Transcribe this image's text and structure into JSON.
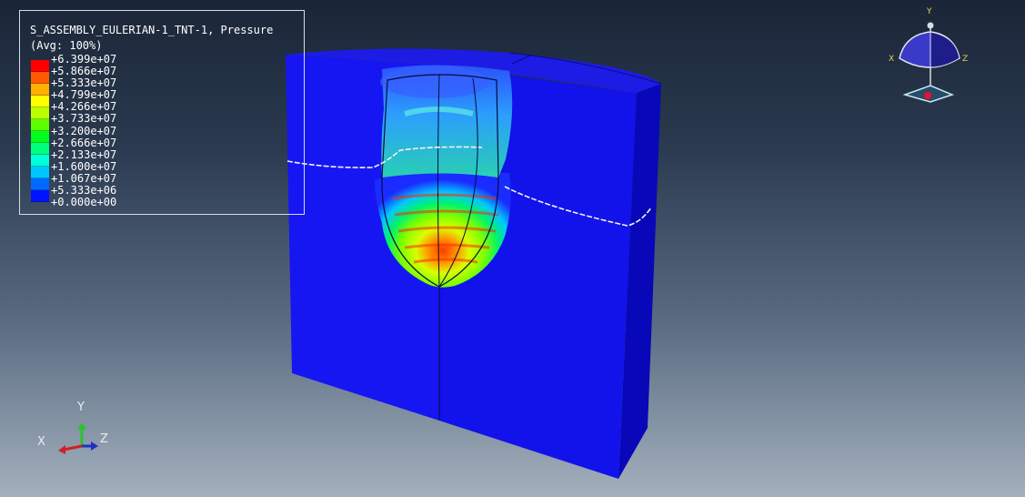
{
  "legend": {
    "title": "S_ASSEMBLY_EULERIAN-1_TNT-1, Pressure",
    "subtitle": "(Avg: 100%)",
    "values": [
      "+6.399e+07",
      "+5.866e+07",
      "+5.333e+07",
      "+4.799e+07",
      "+4.266e+07",
      "+3.733e+07",
      "+3.200e+07",
      "+2.666e+07",
      "+2.133e+07",
      "+1.600e+07",
      "+1.067e+07",
      "+5.333e+06",
      "+0.000e+00"
    ],
    "colors": [
      "#ff0000",
      "#ff5a00",
      "#ffb000",
      "#ffff00",
      "#b9ff00",
      "#5cff00",
      "#00ff21",
      "#00ff7e",
      "#00ffdc",
      "#00c6ff",
      "#006aff",
      "#0014ff"
    ]
  },
  "view_cube": {
    "axis_y": "Y",
    "axis_x": "X",
    "axis_z": "Z"
  },
  "triad": {
    "axis_y": "Y",
    "axis_x": "X",
    "axis_z": "Z"
  },
  "colors": {
    "model_front": "#1414f0",
    "model_side": "#0a0ac8",
    "model_top": "#1e1ee6"
  }
}
